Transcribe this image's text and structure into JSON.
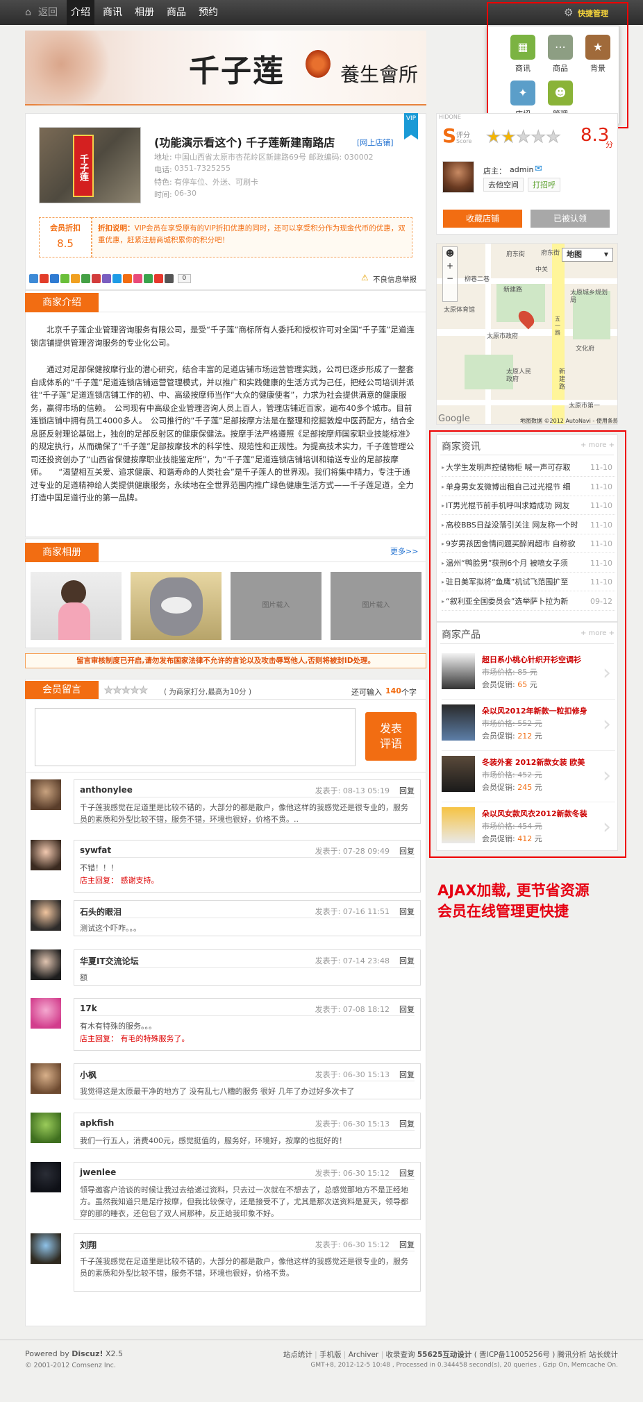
{
  "topnav": {
    "back": "返回",
    "tabs": [
      "介绍",
      "商讯",
      "相册",
      "商品",
      "预约"
    ],
    "quick_manage": "快捷管理"
  },
  "quick_menu": {
    "items": [
      {
        "label": "商讯",
        "color": "#7bb342"
      },
      {
        "label": "商品",
        "color": "#8d9e83"
      },
      {
        "label": "背景",
        "color": "#a06a3a"
      },
      {
        "label": "店招",
        "color": "#5b9ec9"
      },
      {
        "label": "管理",
        "color": "#8ab338"
      }
    ]
  },
  "banner": {
    "brand": "千子莲",
    "sub": "養生會所"
  },
  "shop": {
    "name": "(功能演示看这个) 千子莲新建南路店",
    "online": "[网上店铺]",
    "vip": "VIP",
    "sign_image_text": "千子莲",
    "address_label": "地址:",
    "address": "中国山西省太原市杏花岭区新建路69号 邮政编码: 030002",
    "phone_label": "电话:",
    "phone": "0351-7325255",
    "feature_label": "特色:",
    "feature": "有停车位、外送、可刷卡",
    "hours_label": "时间:",
    "hours": "06-30",
    "discount_title": "会员折扣",
    "discount_value": "8.5",
    "discount_note_label": "折扣说明：",
    "discount_note": "VIP会员在享受原有的VIP折扣优惠的同时，还可以享受积分作为现金代币的优惠，双重优惠，赶紧注册商城积累你的积分吧！",
    "share_count": "0",
    "report": "不良信息举报"
  },
  "score": {
    "s_label": "评分",
    "score_sub": "Score",
    "rating": 2,
    "max": 5,
    "value": "8.3",
    "unit": "分",
    "owner_label": "店主：",
    "owner": "admin",
    "visit": "去他空间",
    "greet": "打招呼",
    "fav": "收藏店铺",
    "claimed": "已被认领",
    "box_title": "HIDONE"
  },
  "map": {
    "type_label": "地图",
    "labels": [
      "府东街",
      "府东街",
      "新建路",
      "新建路",
      "柳巷二巷",
      "太原体育馆",
      "太原市政府",
      "太原人民政府",
      "太原市第一",
      "五一路",
      "中关",
      "太原城乡规划局",
      "文化府"
    ],
    "copyright": "地图数据 ©2012 AutoNavi - 使用条款",
    "google": "Google"
  },
  "intro": {
    "title": "商家介绍",
    "p1": "北京千子莲企业管理咨询服务有限公司，是受“千子莲”商标所有人委托和授权许可对全国“千子莲”足道连锁店铺提供管理咨询服务的专业化公司。",
    "p2": "通过对足部保健按摩行业的潜心研究，结合丰富的足道店铺市场运营管理实践，公司已逐步形成了一整套自成体系的“千子莲”足道连锁店铺运营管理模式，并以推广和实践健康的生活方式为己任，把经公司培训并派往“千子莲”足道连锁店铺工作的初、中、高级按摩师当作“大众的健康使者”，力求为社会提供满意的健康服务，赢得市场的信赖。　公司现有中高级企业管理咨询人员上百人，管理店铺近百家，遍布40多个城市。目前连锁店铺中拥有员工4000多人。　公司推行的“千子莲”足部按摩方法是在整理和挖掘敦煌中医药配方，结合全息胚反射理论基础上，独创的足部反射区的健康保健法。按摩手法严格遵照《足部按摩师国家职业技能标准》的规定执行，从而确保了“千子莲”足部按摩技术的科学性、规范性和正规性。为提高技术实力，千子莲管理公司还投资创办了“山西省保健按摩职业技能鉴定所”，为“千子莲”足道连锁店铺培训和输送专业的足部按摩师。　　“渴望相互关爱、追求健康、和谐寿命的人类社会”是千子莲人的世界观。我们将集中精力，专注于通过专业的足道精神给人类提供健康服务，永续地在全世界范围内推广绿色健康生活方式——千子莲足道，全力打造中国足道行业的第一品牌。"
  },
  "album": {
    "title": "商家相册",
    "more": "更多>>",
    "placeholder": "图片载入"
  },
  "notice": "留言审核制度已开启,请勿发布国家法律不允许的言论以及攻击辱骂他人,否则将被封ID处理。",
  "guestbook": {
    "title": "会员留言",
    "hint": "( 为商家打分,最高为10分 )",
    "remain_prefix": "还可输入",
    "remain": "140",
    "remain_suffix": "个字",
    "submit": "发表评语"
  },
  "comments": [
    {
      "name": "anthonylee",
      "time": "发表于: 08-13 05:19",
      "reply": "回复",
      "text": "千子莲我感觉在足道里是比较不错的，大部分的都是散户，像他这样的我感觉还是很专业的，服务员的素质和外型比较不错，服务不错，环境也很好，价格不贵。..",
      "shop_reply_label": "",
      "shop_reply": ""
    },
    {
      "name": "sywfat",
      "time": "发表于: 07-28 09:49",
      "reply": "回复",
      "text": "不错！！！",
      "shop_reply_label": "店主回复：",
      "shop_reply": "感谢支持。"
    },
    {
      "name": "石头的眼泪",
      "time": "发表于: 07-16 11:51",
      "reply": "回复",
      "text": "测试这个吓咋。。。",
      "shop_reply_label": "",
      "shop_reply": ""
    },
    {
      "name": "华夏IT交流论坛",
      "time": "发表于: 07-14 23:48",
      "reply": "回复",
      "text": "额",
      "shop_reply_label": "",
      "shop_reply": ""
    },
    {
      "name": "17k",
      "time": "发表于: 07-08 18:12",
      "reply": "回复",
      "text": "有木有特殊的服务。。。",
      "shop_reply_label": "店主回复：",
      "shop_reply": "有毛的特殊服务了。"
    },
    {
      "name": "小枫",
      "time": "发表于: 06-30 15:13",
      "reply": "回复",
      "text": "我觉得这是太原最干净的地方了 没有乱七八糟的服务 很好 几年了办过好多次卡了",
      "shop_reply_label": "",
      "shop_reply": ""
    },
    {
      "name": "apkfish",
      "time": "发表于: 06-30 15:13",
      "reply": "回复",
      "text": "我们一行五人，消费400元，感觉挺值的，服务好，环境好，按摩的也挺好的！",
      "shop_reply_label": "",
      "shop_reply": ""
    },
    {
      "name": "jwenlee",
      "time": "发表于: 06-30 15:12",
      "reply": "回复",
      "text": "领导邀客户洽谈的时候让我过去给递过资料，只去过一次就在不想去了，总感觉那地方不是正经地方。虽然我知道只是足疗按摩，但我比较保守，还是接受不了，尤其是那次送资料是夏天，领导都穿的那的睡衣，还包包了双人间那种，反正给我印象不好。",
      "shop_reply_label": "",
      "shop_reply": ""
    },
    {
      "name": "刘翔",
      "time": "发表于: 06-30 15:12",
      "reply": "回复",
      "text": "千子莲我感觉在足道里是比较不错的，大部分的都是散户，像他这样的我感觉还是很专业的，服务员的素质和外型比较不错，服务不错，环境也很好，价格不贵。",
      "shop_reply_label": "",
      "shop_reply": ""
    }
  ],
  "news": {
    "title": "商家资讯",
    "more": "+ more +",
    "items": [
      {
        "t": "大学生发明声控储物柜 喊一声可存取",
        "d": "11-10"
      },
      {
        "t": "单身男女发微博出租自己过光棍节 细",
        "d": "11-10"
      },
      {
        "t": "IT男光棍节前手机呼叫求婚成功 网友",
        "d": "11-10"
      },
      {
        "t": "高校BBS日益没落引关注 网友称一个时",
        "d": "11-10"
      },
      {
        "t": "9岁男孩因舍情问题买醉闹超市 自称欲",
        "d": "11-10"
      },
      {
        "t": "温州“鸭脸男”获刑6个月 被喷女子须",
        "d": "11-10"
      },
      {
        "t": "驻日美军拟将“鱼鹰”机试飞范围扩至",
        "d": "11-10"
      },
      {
        "t": "“叙利亚全国委员会”选举萨卜拉为新",
        "d": "09-12"
      }
    ]
  },
  "products": {
    "title": "商家产品",
    "more": "+ more +",
    "orig_label": "市场价格:",
    "promo_label": "会员促销:",
    "currency": "元",
    "items": [
      {
        "name": "超日系小桃心针织开衫空调衫",
        "orig": "85",
        "promo": "65"
      },
      {
        "name": "朵以风2012年新款一粒扣修身",
        "orig": "552",
        "promo": "212"
      },
      {
        "name": "冬装外套 2012新款女装 欧美",
        "orig": "452",
        "promo": "245"
      },
      {
        "name": "朵以风女款风衣2012新款冬装",
        "orig": "454",
        "promo": "412"
      }
    ]
  },
  "annotation": {
    "line1": "AJAX加载, 更节省资源",
    "line2": "会员在线管理更快捷"
  },
  "footer": {
    "powered": "Powered by",
    "brand": "Discuz!",
    "version": "X2.5",
    "copy": "© 2001-2012 Comsenz Inc.",
    "links": [
      "站点统计",
      "手机版",
      "Archiver",
      "收录查询",
      "55625互动设计",
      "( 晋ICP备11005256号 )",
      "腾讯分析",
      "站长统计"
    ],
    "stats": "GMT+8, 2012-12-5 10:48 , Processed in 0.344458 second(s), 20 queries , Gzip On, Memcache On."
  },
  "colors": {
    "accent": "#f26d12",
    "annotation": "#e60012",
    "price_red": "#c00"
  }
}
